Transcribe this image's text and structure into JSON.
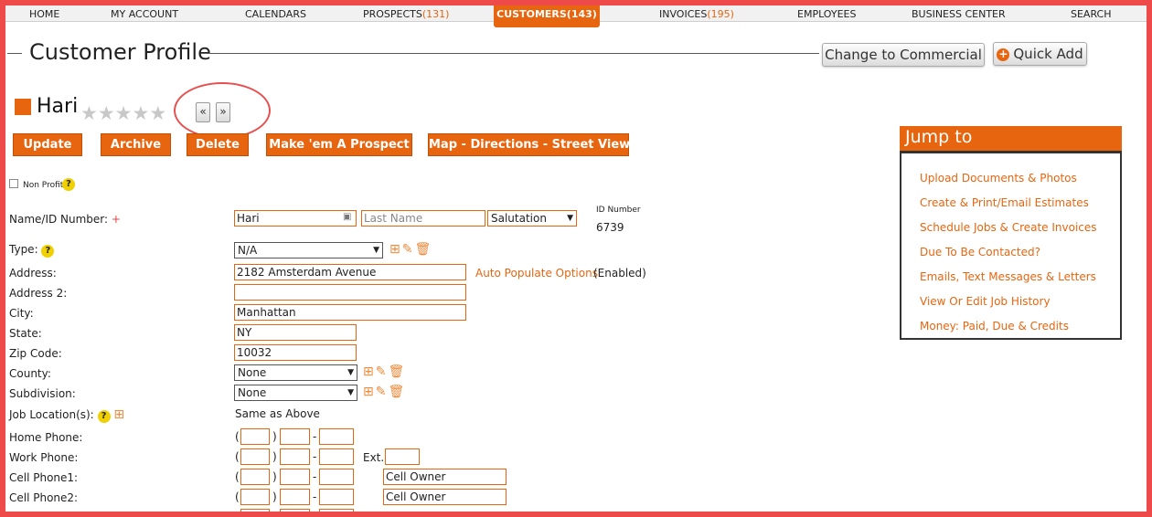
{
  "nav": {
    "items": [
      {
        "label": "HOME",
        "count": ""
      },
      {
        "label": "MY ACCOUNT",
        "count": ""
      },
      {
        "label": "CALENDARS",
        "count": ""
      },
      {
        "label": "PROSPECTS",
        "count": "(131)"
      },
      {
        "label": "CUSTOMERS",
        "count": "(143)"
      },
      {
        "label": "INVOICES",
        "count": "(195)"
      },
      {
        "label": "EMPLOYEES",
        "count": ""
      },
      {
        "label": "BUSINESS CENTER",
        "count": ""
      },
      {
        "label": "SEARCH",
        "count": ""
      }
    ],
    "active_label": "CUSTOMERS(143)"
  },
  "header": {
    "title": "Customer Profile",
    "change_button": "Change to Commercial",
    "quick_add_button": "Quick Add",
    "quick_add_icon": "plus-circle-icon"
  },
  "customer": {
    "name": "Hari",
    "rating_stars": 0,
    "rating_max": 5,
    "prev_label": "«",
    "next_label": "»"
  },
  "actions": {
    "update": "Update",
    "archive": "Archive",
    "delete": "Delete",
    "make_prospect": "Make 'em A Prospect",
    "map": "Map - Directions - Street View"
  },
  "jump_to": {
    "title": "Jump to",
    "links": [
      "Upload Documents & Photos",
      "Create & Print/Email Estimates",
      "Schedule Jobs & Create Invoices",
      "Due To Be Contacted?",
      "Emails, Text Messages & Letters",
      "View Or Edit Job History",
      "Money: Paid, Due & Credits"
    ]
  },
  "form": {
    "non_profit_label": "Non Profit",
    "name_label": "Name/ID Number:",
    "required_mark": "+",
    "first_name": "Hari",
    "last_name_placeholder": "Last Name",
    "salutation": "Salutation",
    "id_number_label": "ID Number",
    "id_number": "6739",
    "type_label": "Type:",
    "type_value": "N/A",
    "address_label": "Address:",
    "address_value": "2182 Amsterdam Avenue",
    "auto_populate_link": "Auto Populate Options",
    "auto_populate_status": "(Enabled)",
    "address2_label": "Address 2:",
    "address2_value": "",
    "city_label": "City:",
    "city_value": "Manhattan",
    "state_label": "State:",
    "state_value": "NY",
    "zip_label": "Zip Code:",
    "zip_value": "10032",
    "county_label": "County:",
    "county_value": "None",
    "subdivision_label": "Subdivision:",
    "subdivision_value": "None",
    "job_location_label": "Job Location(s):",
    "job_location_value": "Same as Above",
    "home_phone_label": "Home Phone:",
    "work_phone_label": "Work Phone:",
    "ext_label": "Ext.",
    "cell1_label": "Cell Phone1:",
    "cell1_owner": "Cell Owner",
    "cell2_label": "Cell Phone2:",
    "cell2_owner": "Cell Owner"
  },
  "colors": {
    "accent": "#e8650f",
    "frame": "#ef4a4a",
    "help": "#f0d000"
  }
}
